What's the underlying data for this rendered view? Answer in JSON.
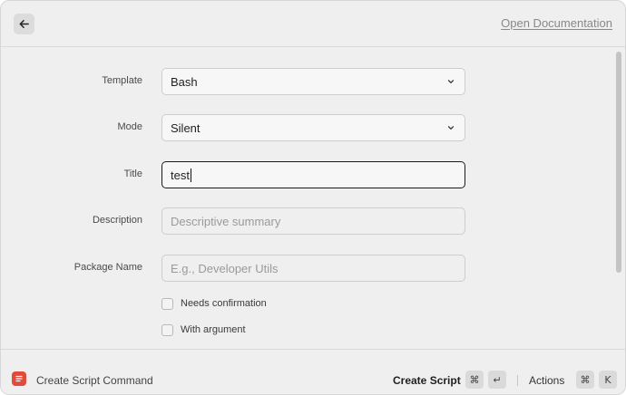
{
  "header": {
    "back_icon": "arrow-left-icon",
    "doc_link": "Open Documentation"
  },
  "form": {
    "template": {
      "label": "Template",
      "value": "Bash"
    },
    "mode": {
      "label": "Mode",
      "value": "Silent"
    },
    "title": {
      "label": "Title",
      "value": "test"
    },
    "description": {
      "label": "Description",
      "placeholder": "Descriptive summary"
    },
    "package_name": {
      "label": "Package Name",
      "placeholder": "E.g., Developer Utils"
    },
    "needs_confirmation": {
      "label": "Needs confirmation",
      "checked": false
    },
    "with_argument": {
      "label": "With argument",
      "checked": false
    }
  },
  "footer": {
    "app_icon": "script-command-icon",
    "app_color": "#e24a3b",
    "app_title": "Create Script Command",
    "primary_action": "Create Script",
    "primary_keys": [
      "⌘",
      "↵"
    ],
    "actions_label": "Actions",
    "actions_keys": [
      "⌘",
      "K"
    ]
  }
}
